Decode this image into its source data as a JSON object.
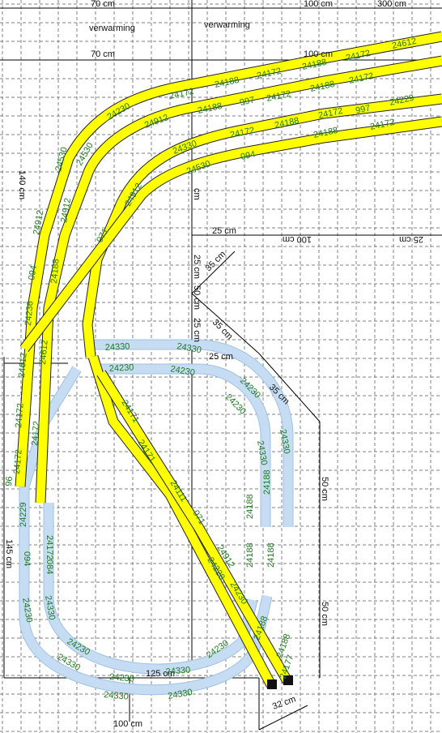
{
  "rooms": {
    "heating_left": "verwarming",
    "heating_right": "verwarming"
  },
  "dimensions": {
    "top_70a": "70 cm",
    "top_100": "100 cm",
    "top_300": "300 cm",
    "mid_70": "70 cm",
    "mid_100": "100 cm",
    "left_140": "140 cm",
    "left_145": "145 cm",
    "cm_small": "cm",
    "d25a": "25 cm",
    "d25b": "25 cm",
    "d25c": "25 cm",
    "d25d": "25 cm",
    "d35a": "35 cm",
    "d35b": "35 cm",
    "d35c": "35 cm",
    "d50a": "50 cm",
    "d50b": "50 cm",
    "d50c": "50 cm",
    "d100r": "100 cm",
    "d25r": "25 cm",
    "d125": "125 cm",
    "d100b": "100 cm",
    "d32": "32 cm"
  },
  "track_labels": {
    "outer": [
      "24612",
      "24172",
      "24188",
      "24172",
      "24188",
      "24172",
      "24172",
      "24230",
      "24530",
      "24912",
      "094",
      "24188",
      "24236",
      "24612",
      "24172",
      "24172",
      "24172",
      "96"
    ],
    "inner": [
      "24912",
      "24188",
      "997",
      "24172",
      "24188",
      "24172",
      "24530",
      "24912",
      "24188",
      "24172",
      "097",
      "094",
      "24612",
      "96",
      "24172",
      "96"
    ],
    "middle": [
      "24229",
      "997",
      "24172",
      "24188",
      "24172",
      "24188",
      "24172",
      "24330",
      "24530",
      "094",
      "24188",
      "24912",
      "24171",
      "071",
      "084"
    ],
    "curve_blue": [
      "24330",
      "24330",
      "24230",
      "24230",
      "24230",
      "24230",
      "24330",
      "24330",
      "24188",
      "24188",
      "24188",
      "24188",
      "24330",
      "24230"
    ],
    "bottom_blue": [
      "24229",
      "24172",
      "084",
      "094",
      "24230",
      "24330",
      "24230",
      "24330",
      "24330",
      "24230",
      "24330",
      "24230",
      "24330"
    ],
    "diag": [
      "24171",
      "24111",
      "071",
      "24912",
      "24228",
      "24230",
      "24188",
      "24171",
      "24172",
      "24188",
      "24177",
      "24330"
    ]
  },
  "colors": {
    "track_yellow": "#ffff00",
    "track_blue": "#c6dcf3",
    "grid": "#7a7a7a",
    "label_green": "#1f7a1f"
  }
}
